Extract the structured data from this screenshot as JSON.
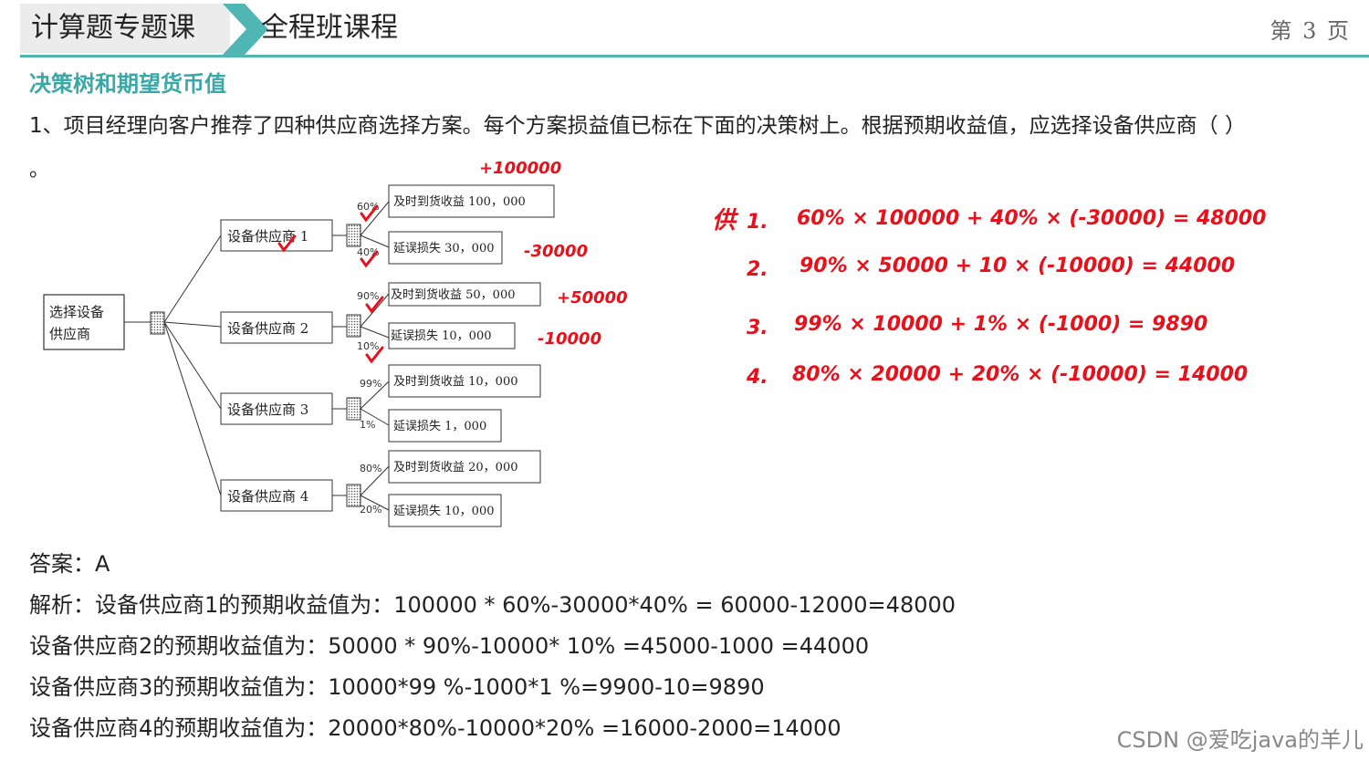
{
  "header": {
    "course": "计算题专题课",
    "course_series": "全程班课程",
    "page_label": "第 3 页"
  },
  "section_title": "决策树和期望货币值",
  "question": {
    "text": "1、项目经理向客户推荐了四种供应商选择方案。每个方案损益值已标在下面的决策树上。根据预期收益值，应选择设备供应商（ ）",
    "trailing": "。"
  },
  "tree": {
    "root": "选择设备",
    "root2": "供应商",
    "suppliers": [
      {
        "label": "设备供应商 1",
        "p_good": "60%",
        "good": "及时到货收益 100，000",
        "p_bad": "40%",
        "bad": "延误损失 30，000"
      },
      {
        "label": "设备供应商 2",
        "p_good": "90%",
        "good": "及时到货收益 50，000",
        "p_bad": "10%",
        "bad": "延误损失 10，000"
      },
      {
        "label": "设备供应商 3",
        "p_good": "99%",
        "good": "及时到货收益 10，000",
        "p_bad": "1%",
        "bad": "延误损失 1，000"
      },
      {
        "label": "设备供应商 4",
        "p_good": "80%",
        "good": "及时到货收益 20，000",
        "p_bad": "20%",
        "bad": "延误损失 10，000"
      }
    ]
  },
  "handwriting": {
    "n1": "+100000",
    "n2": "-30000",
    "n3": "+50000",
    "n4": "-10000",
    "label": "供",
    "line1_no": "1.",
    "line1": "60% × 100000 + 40% × (-30000) = 48000",
    "line2_no": "2.",
    "line2": "90% × 50000 + 10 × (-10000) = 44000",
    "line3_no": "3.",
    "line3": "99% × 10000 + 1% × (-1000) = 9890",
    "line4_no": "4.",
    "line4": "80% × 20000 + 20% × (-10000) = 14000"
  },
  "answer": {
    "answer_line": "答案：A",
    "analysis1": "解析：设备供应商1的预期收益值为：100000 * 60%-30000*40% = 60000-12000=48000",
    "analysis2": "设备供应商2的预期收益值为：50000 * 90%-10000* 10% =45000-1000 =44000",
    "analysis3": "设备供应商3的预期收益值为：10000*99 %-1000*1 %=9900-10=9890",
    "analysis4": "设备供应商4的预期收益值为：20000*80%-10000*20% =16000-2000=14000"
  },
  "watermark": "CSDN @爱吃java的羊儿",
  "colors": {
    "accent": "#3aa8a6",
    "rule": "#4fb6b4",
    "ink": "#e8101a"
  }
}
